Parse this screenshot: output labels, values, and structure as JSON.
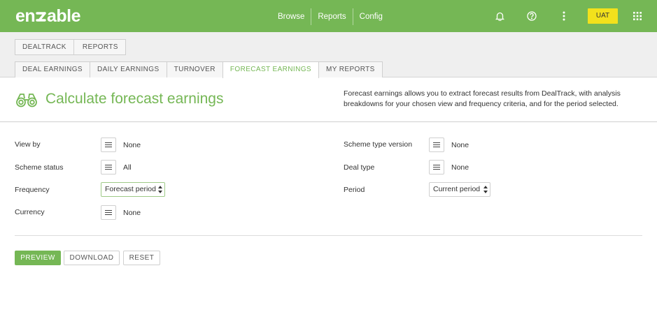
{
  "brand": {
    "logo_text": "enable",
    "accent": "#75b755",
    "env_color": "#f2e11c"
  },
  "topnav": {
    "items": [
      "Browse",
      "Reports",
      "Config"
    ],
    "env_badge": "UAT"
  },
  "icons": [
    "bell-icon",
    "help-icon",
    "more-vertical-icon",
    "apps-grid-icon"
  ],
  "breadcrumb": [
    "DEALTRACK",
    "REPORTS"
  ],
  "tabs": [
    "DEAL EARNINGS",
    "DAILY EARNINGS",
    "TURNOVER",
    "FORECAST EARNINGS",
    "MY REPORTS"
  ],
  "active_tab": "FORECAST EARNINGS",
  "page": {
    "title": "Calculate forecast earnings",
    "description": "Forecast earnings allows you to extract forecast results from DealTrack, with analysis breakdowns for your chosen view and frequency criteria, and for the period selected."
  },
  "form": {
    "view_by": {
      "label": "View by",
      "value": "None"
    },
    "scheme_status": {
      "label": "Scheme status",
      "value": "All"
    },
    "frequency": {
      "label": "Frequency",
      "value": "Forecast period"
    },
    "currency": {
      "label": "Currency",
      "value": "None"
    },
    "scheme_type_version": {
      "label": "Scheme type version",
      "value": "None"
    },
    "deal_type": {
      "label": "Deal type",
      "value": "None"
    },
    "period": {
      "label": "Period",
      "value": "Current period"
    }
  },
  "actions": {
    "preview": "PREVIEW",
    "download": "DOWNLOAD",
    "reset": "RESET"
  }
}
